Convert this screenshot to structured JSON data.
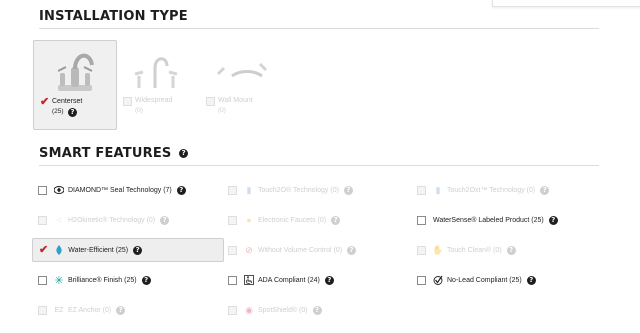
{
  "installation": {
    "title": "INSTALLATION TYPE",
    "types": [
      {
        "label": "Centerset",
        "count": "(25)",
        "selected": true,
        "enabled": true
      },
      {
        "label": "Widespread",
        "count": "(0)",
        "selected": false,
        "enabled": false
      },
      {
        "label": "Wall Mount",
        "count": "(0)",
        "selected": false,
        "enabled": false
      }
    ],
    "help_glyph": "?"
  },
  "smart_features": {
    "title": "SMART FEATURES",
    "help_glyph": "?",
    "items": [
      {
        "label": "DIAMOND™ Seal Technology",
        "count": "(7)",
        "icon": "diamond-icon",
        "enabled": true,
        "selected": false
      },
      {
        "label": "Touch2O® Technology",
        "count": "(0)",
        "icon": "touch-icon",
        "enabled": false,
        "selected": false
      },
      {
        "label": "Touch2Oxt™ Technology",
        "count": "(0)",
        "icon": "touchxt-icon",
        "enabled": false,
        "selected": false
      },
      {
        "label": "H2Okinetic® Technology",
        "count": "(0)",
        "icon": "droplets-icon",
        "enabled": false,
        "selected": false
      },
      {
        "label": "Electronic Faucets",
        "count": "(0)",
        "icon": "lightbulb-icon",
        "enabled": false,
        "selected": false
      },
      {
        "label": "WaterSense® Labeled Product",
        "count": "(25)",
        "icon": "",
        "enabled": true,
        "selected": false
      },
      {
        "label": "Water-Efficient",
        "count": "(25)",
        "icon": "leaf-drop-icon",
        "enabled": true,
        "selected": true
      },
      {
        "label": "Without Volume Control",
        "count": "(0)",
        "icon": "volume-icon",
        "enabled": false,
        "selected": false
      },
      {
        "label": "Touch Clean®",
        "count": "(0)",
        "icon": "hand-icon",
        "enabled": false,
        "selected": false
      },
      {
        "label": "Brilliance® Finish",
        "count": "(25)",
        "icon": "sparkle-icon",
        "enabled": true,
        "selected": false
      },
      {
        "label": "ADA Compliant",
        "count": "(24)",
        "icon": "wheelchair-icon",
        "enabled": true,
        "selected": false
      },
      {
        "label": "No-Lead Compliant",
        "count": "(25)",
        "icon": "check-circle-icon",
        "enabled": true,
        "selected": false
      },
      {
        "label": "EZ Anchor",
        "count": "(0)",
        "icon": "anchor-icon",
        "enabled": false,
        "selected": false
      },
      {
        "label": "SpotShield®",
        "count": "(0)",
        "icon": "shield-icon",
        "enabled": false,
        "selected": false
      }
    ]
  },
  "colors": {
    "accent_check": "#c1272d",
    "brilliance": "#12a5a0",
    "water": "#2a9fd6"
  }
}
